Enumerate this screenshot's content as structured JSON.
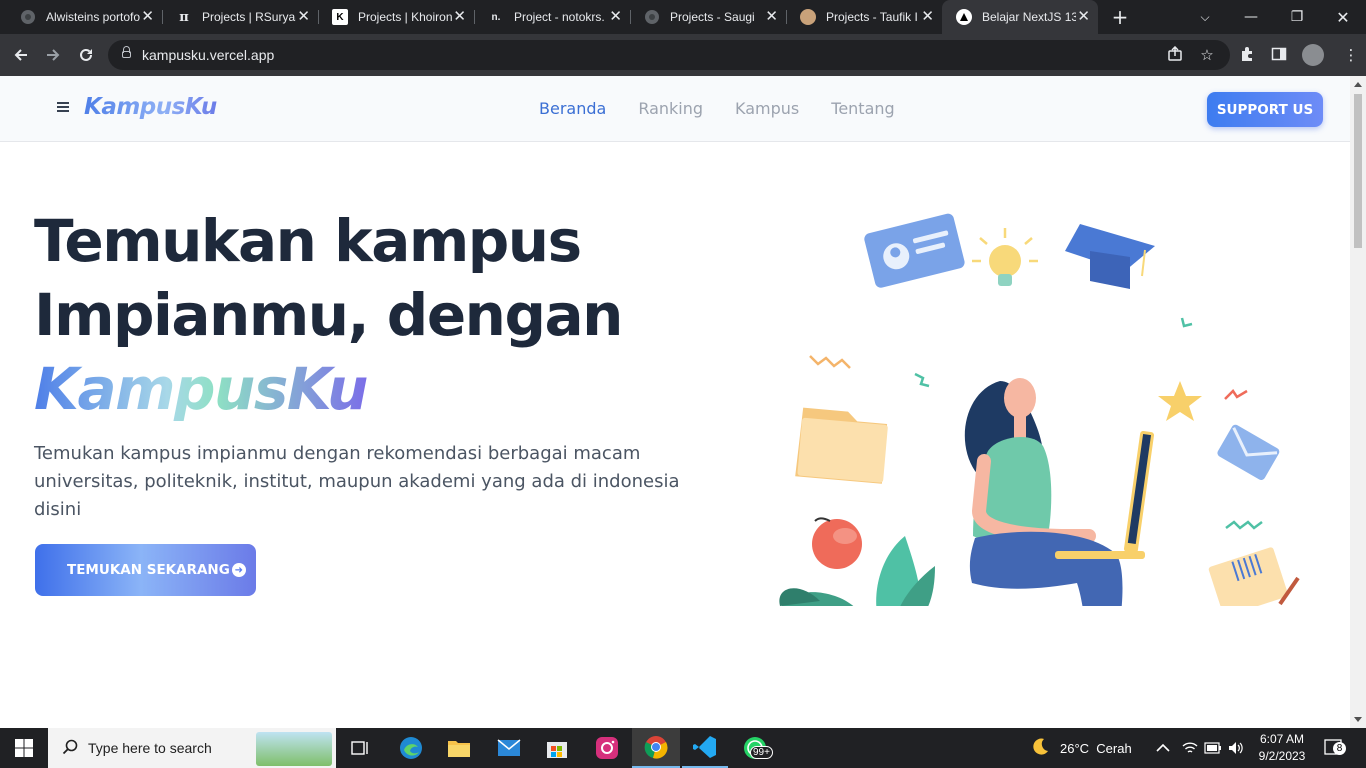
{
  "browser": {
    "tabs": [
      {
        "title": "Alwisteins portofo",
        "favicon": "globe-icon",
        "favicon_color": "#5f6368"
      },
      {
        "title": "Projects | RSuryaS",
        "favicon": "pi-icon",
        "favicon_color": "#e8eaed"
      },
      {
        "title": "Projects | Khoiron",
        "favicon": "k-icon",
        "favicon_color": "#ffffff"
      },
      {
        "title": "Project - notokrs.",
        "favicon": "n-icon",
        "favicon_color": "#e8eaed"
      },
      {
        "title": "Projects - Saugi",
        "favicon": "globe-icon",
        "favicon_color": "#5f6368"
      },
      {
        "title": "Projects - Taufik I",
        "favicon": "avatar-icon",
        "favicon_color": "#c9a27a"
      },
      {
        "title": "Belajar NextJS 13",
        "favicon": "triangle-icon",
        "favicon_color": "#ffffff",
        "active": true
      }
    ],
    "url": "kampusku.vercel.app"
  },
  "site": {
    "logo": "KampusKu",
    "nav": [
      {
        "label": "Beranda",
        "active": true
      },
      {
        "label": "Ranking"
      },
      {
        "label": "Kampus"
      },
      {
        "label": "Tentang"
      }
    ],
    "support_label": "SUPPORT US",
    "hero": {
      "line1": "Temukan kampus",
      "line2": "Impianmu, dengan",
      "brand": "KampusKu",
      "description": "Temukan kampus impianmu dengan rekomendasi berbagai macam universitas, politeknik, institut, maupun akademi yang ada di indonesia disini",
      "cta_label": "TEMUKAN SEKARANG"
    }
  },
  "taskbar": {
    "search_placeholder": "Type here to search",
    "weather": "26°C  Cerah",
    "time": "6:07 AM",
    "date": "9/2/2023",
    "whatsapp_badge": "99+",
    "notification_count": "8"
  },
  "colors": {
    "accent": "#3b6fd4",
    "heading": "#1e293b"
  }
}
